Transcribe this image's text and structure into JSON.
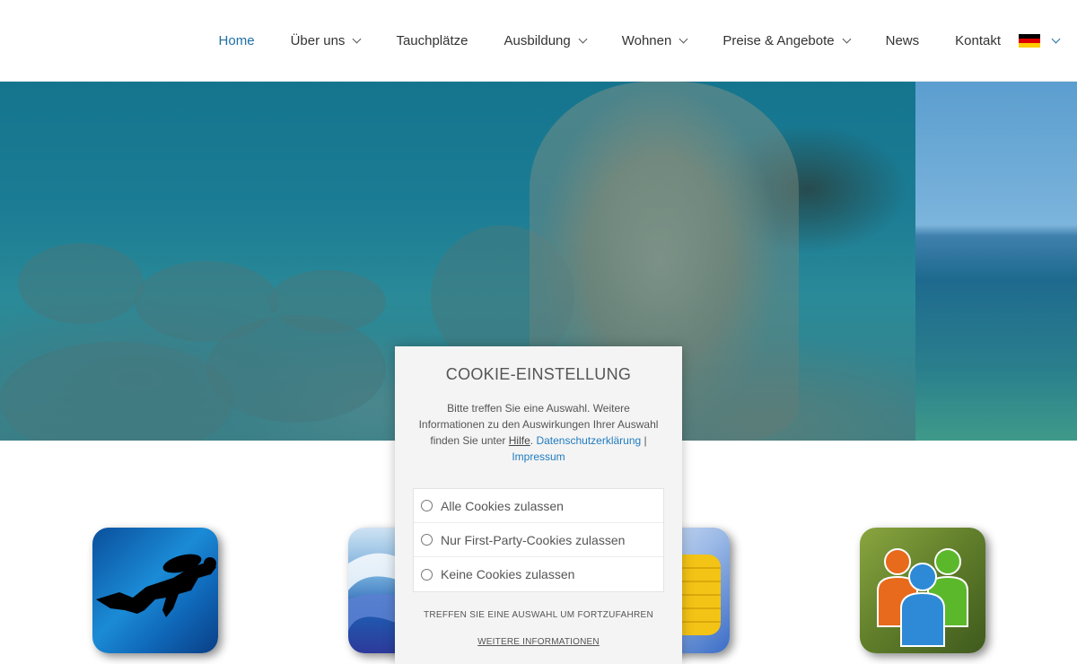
{
  "nav": {
    "items": [
      {
        "label": "Home",
        "active": true,
        "dropdown": false
      },
      {
        "label": "Über uns",
        "active": false,
        "dropdown": true
      },
      {
        "label": "Tauchplätze",
        "active": false,
        "dropdown": false
      },
      {
        "label": "Ausbildung",
        "active": false,
        "dropdown": true
      },
      {
        "label": "Wohnen",
        "active": false,
        "dropdown": true
      },
      {
        "label": "Preise & Angebote",
        "active": false,
        "dropdown": true
      },
      {
        "label": "News",
        "active": false,
        "dropdown": false
      },
      {
        "label": "Kontakt",
        "active": false,
        "dropdown": false
      }
    ],
    "language_icon": "germany-flag-icon",
    "active_color": "#1f6fa5"
  },
  "hero": {
    "images": [
      "underwater-statue-image",
      "sea-horizon-image"
    ]
  },
  "features": [
    {
      "icon": "scuba-diver-icon"
    },
    {
      "icon": "sea-waves-icon"
    },
    {
      "icon": "gold-coins-icon"
    },
    {
      "icon": "people-group-icon"
    }
  ],
  "cookie": {
    "title": "COOKIE-EINSTELLUNG",
    "text_before": "Bitte treffen Sie eine Auswahl. Weitere Informationen zu den Auswirkungen Ihrer Auswahl finden Sie unter ",
    "help_link": "Hilfe",
    "separator": ". ",
    "privacy_link": "Datenschutzerklärung",
    "pipe": " | ",
    "imprint_link": "Impressum",
    "options": [
      "Alle Cookies zulassen",
      "Nur First-Party-Cookies zulassen",
      "Keine Cookies zulassen"
    ],
    "hint": "TREFFEN SIE EINE AUSWAHL UM FORTZUFAHREN",
    "more_info": "WEITERE INFORMATIONEN",
    "link_color": "#1f7bbf"
  }
}
